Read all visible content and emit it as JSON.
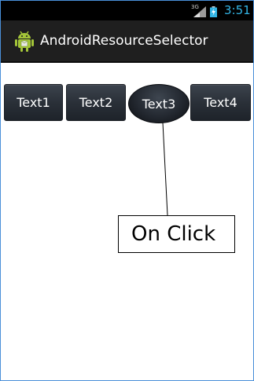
{
  "status_bar": {
    "network_label": "3G",
    "time": "3:51",
    "time_color": "#33b5e5"
  },
  "action_bar": {
    "title": "AndroidResourceSelector",
    "icon": "android-icon"
  },
  "buttons": [
    {
      "label": "Text1"
    },
    {
      "label": "Text2"
    },
    {
      "label": "Text3",
      "state": "pressed"
    },
    {
      "label": "Text4"
    }
  ],
  "annotation": {
    "label": "On Click"
  }
}
